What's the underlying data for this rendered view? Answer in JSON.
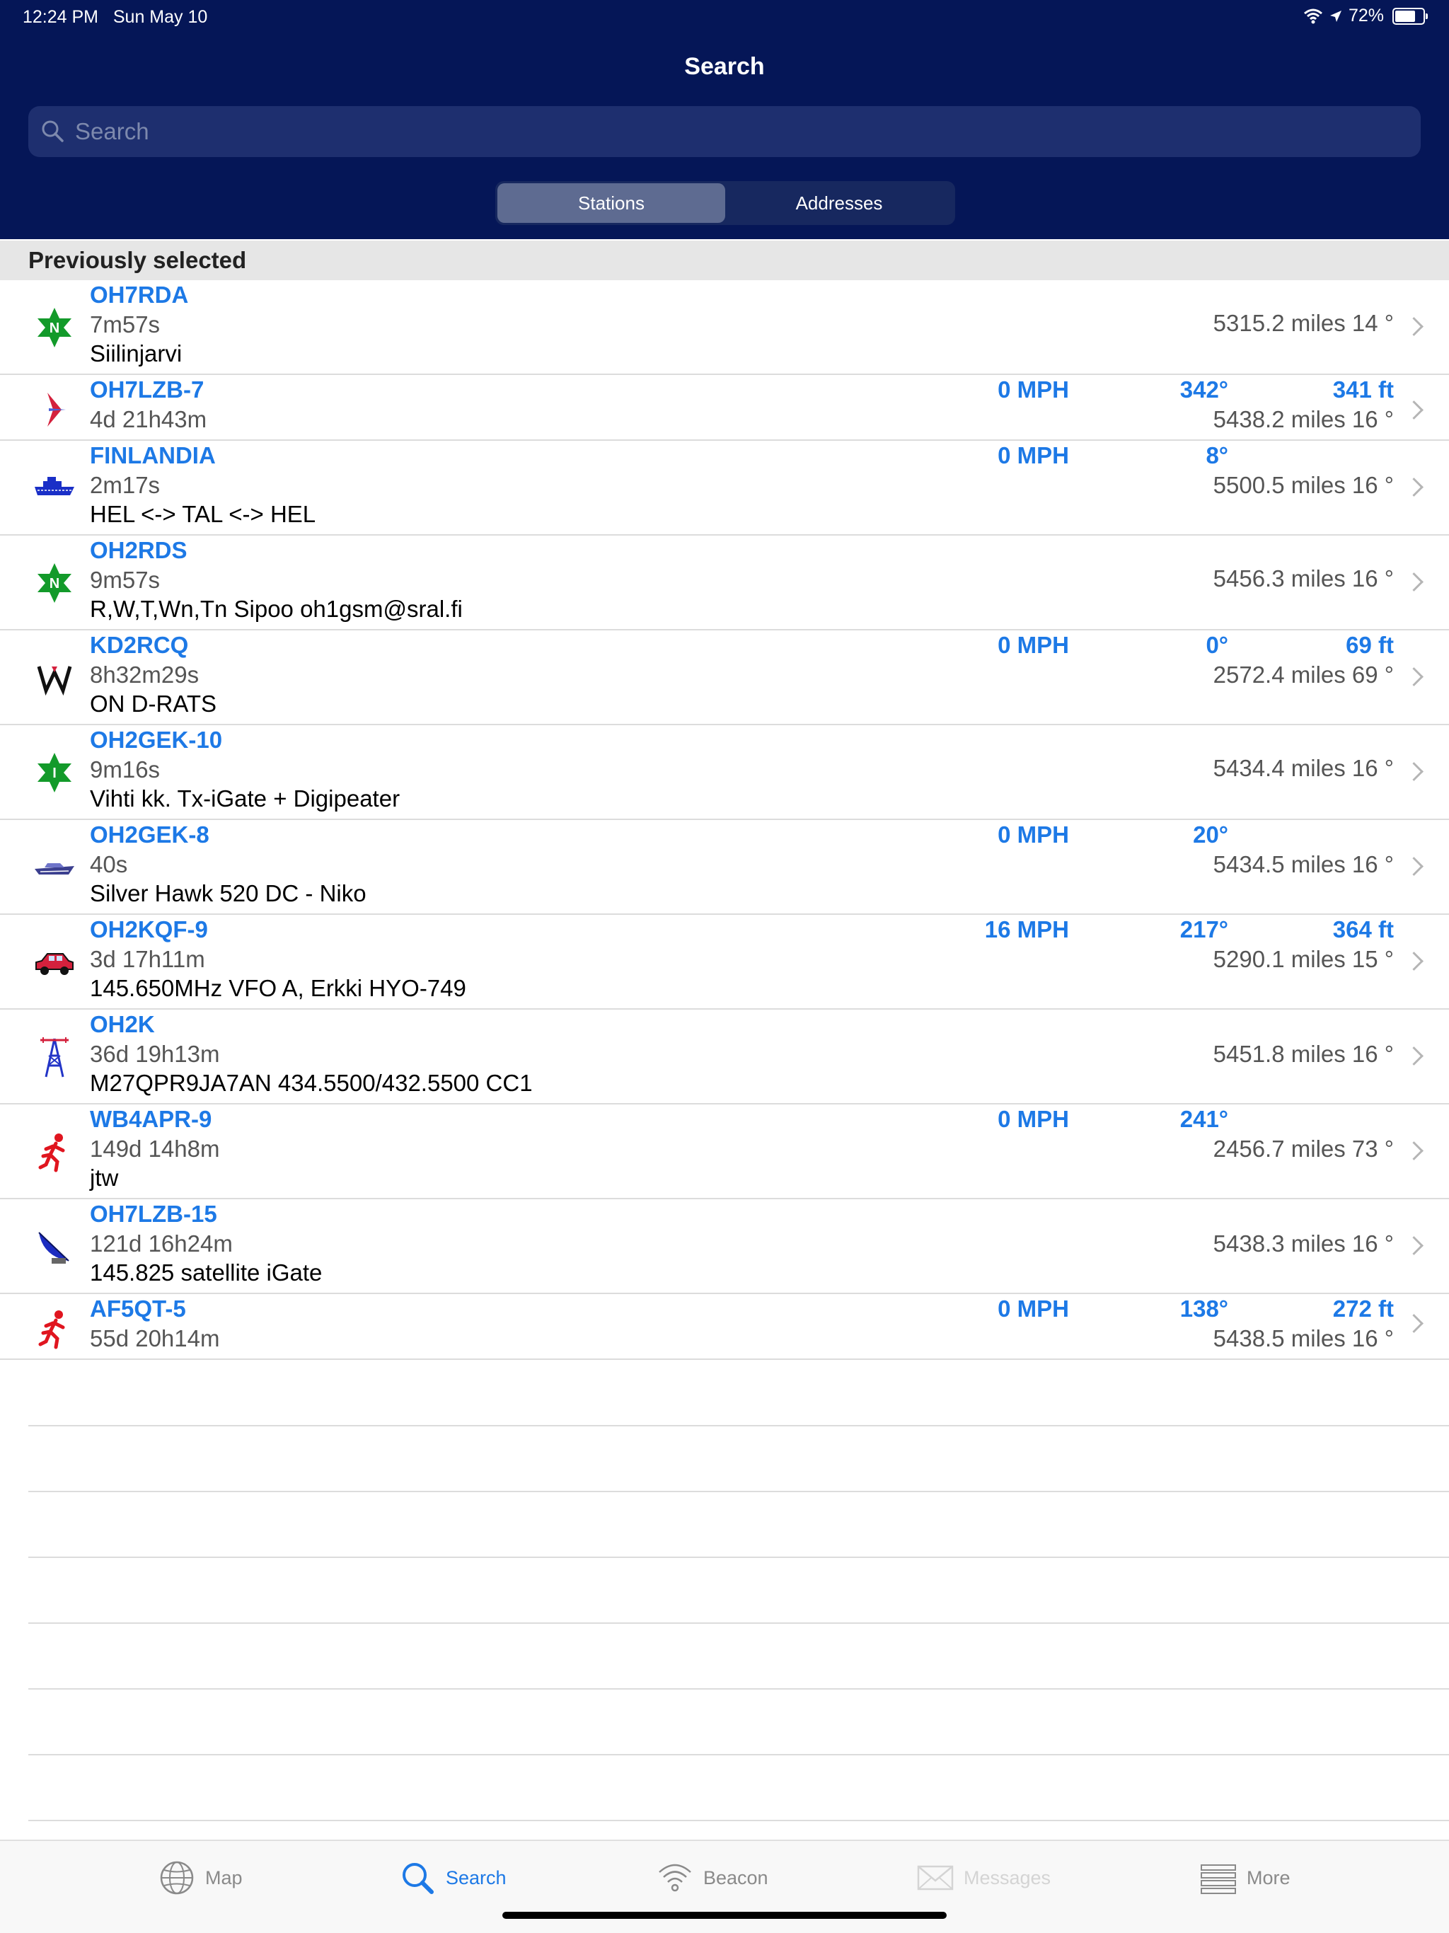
{
  "status_bar": {
    "time": "12:24 PM",
    "date": "Sun May 10",
    "battery": "72%"
  },
  "nav": {
    "title": "Search"
  },
  "search": {
    "placeholder": "Search",
    "value": ""
  },
  "segments": [
    {
      "label": "Stations",
      "active": true
    },
    {
      "label": "Addresses",
      "active": false
    }
  ],
  "section": {
    "title": "Previously selected"
  },
  "rows": [
    {
      "call": "OH7RDA",
      "age": "7m57s",
      "comment": "Siilinjarvi",
      "speed": "",
      "course": "",
      "alt": "",
      "dist": "5315.2 miles 14 °",
      "icon": "digipeater-n-icon"
    },
    {
      "call": "OH7LZB-7",
      "age": "4d 21h43m",
      "comment": "",
      "speed": "0 MPH",
      "course": "342°",
      "alt": "341 ft",
      "dist": "5438.2 miles 16 °",
      "icon": "aircraft-icon"
    },
    {
      "call": "FINLANDIA",
      "age": "2m17s",
      "comment": "HEL <-> TAL <-> HEL",
      "speed": "0 MPH",
      "course": "8°",
      "alt": "",
      "dist": "5500.5 miles 16 °",
      "icon": "ship-icon"
    },
    {
      "call": "OH2RDS",
      "age": "9m57s",
      "comment": "R,W,T,Wn,Tn Sipoo oh1gsm@sral.fi",
      "speed": "",
      "course": "",
      "alt": "",
      "dist": "5456.3 miles 16 °",
      "icon": "digipeater-n-icon"
    },
    {
      "call": "KD2RCQ",
      "age": "8h32m29s",
      "comment": "ON D-RATS",
      "speed": "0 MPH",
      "course": "0°",
      "alt": "69 ft",
      "dist": "2572.4 miles 69 °",
      "icon": "weather-w-icon"
    },
    {
      "call": "OH2GEK-10",
      "age": "9m16s",
      "comment": "Vihti kk. Tx-iGate + Digipeater",
      "speed": "",
      "course": "",
      "alt": "",
      "dist": "5434.4 miles 16 °",
      "icon": "digipeater-i-icon"
    },
    {
      "call": "OH2GEK-8",
      "age": "40s",
      "comment": "Silver Hawk 520 DC - Niko",
      "speed": "0 MPH",
      "course": "20°",
      "alt": "",
      "dist": "5434.5 miles 16 °",
      "icon": "boat-icon"
    },
    {
      "call": "OH2KQF-9",
      "age": "3d 17h11m",
      "comment": "145.650MHz VFO A, Erkki HYO-749",
      "speed": "16 MPH",
      "course": "217°",
      "alt": "364 ft",
      "dist": "5290.1 miles 15 °",
      "icon": "car-icon"
    },
    {
      "call": "OH2K",
      "age": "36d 19h13m",
      "comment": "M27QPR9JA7AN 434.5500/432.5500 CC1",
      "speed": "",
      "course": "",
      "alt": "",
      "dist": "5451.8 miles 16 °",
      "icon": "tower-icon"
    },
    {
      "call": "WB4APR-9",
      "age": "149d 14h8m",
      "comment": "jtw",
      "speed": "0 MPH",
      "course": "241°",
      "alt": "",
      "dist": "2456.7 miles 73 °",
      "icon": "jogger-icon"
    },
    {
      "call": "OH7LZB-15",
      "age": "121d 16h24m",
      "comment": "145.825 satellite iGate",
      "speed": "",
      "course": "",
      "alt": "",
      "dist": "5438.3 miles 16 °",
      "icon": "satellite-dish-icon"
    },
    {
      "call": "AF5QT-5",
      "age": "55d 20h14m",
      "comment": "",
      "speed": "0 MPH",
      "course": "138°",
      "alt": "272 ft",
      "dist": "5438.5 miles 16 °",
      "icon": "jogger-icon"
    }
  ],
  "tabs": [
    {
      "label": "Map",
      "icon": "globe-icon",
      "state": "normal"
    },
    {
      "label": "Search",
      "icon": "search-icon",
      "state": "active"
    },
    {
      "label": "Beacon",
      "icon": "beacon-icon",
      "state": "normal"
    },
    {
      "label": "Messages",
      "icon": "envelope-icon",
      "state": "disabled"
    },
    {
      "label": "More",
      "icon": "list-icon",
      "state": "normal"
    }
  ],
  "colors": {
    "header_bg": "#051657",
    "accent": "#1d79e6",
    "section_bg": "#e6e6e6"
  }
}
